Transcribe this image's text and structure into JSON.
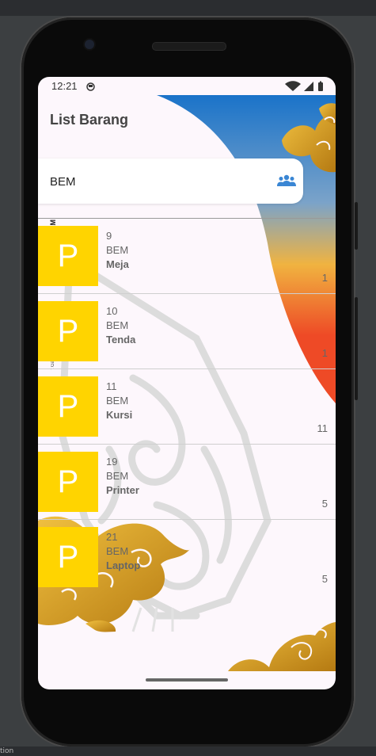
{
  "status_bar": {
    "time": "12:21"
  },
  "app": {
    "title": "List Barang"
  },
  "filter": {
    "value": "BEM",
    "icon": "group-icon"
  },
  "items": [
    {
      "thumb": "P",
      "id": "9",
      "org": "BEM",
      "name": "Meja",
      "qty": "1"
    },
    {
      "thumb": "P",
      "id": "10",
      "org": "BEM",
      "name": "Tenda",
      "qty": "1"
    },
    {
      "thumb": "P",
      "id": "11",
      "org": "BEM",
      "name": "Kursi",
      "qty": "11"
    },
    {
      "thumb": "P",
      "id": "19",
      "org": "BEM",
      "name": "Printer",
      "qty": "5"
    },
    {
      "thumb": "P",
      "id": "21",
      "org": "BEM",
      "name": "Laptop",
      "qty": "5"
    }
  ],
  "background_text": {
    "vertical_1": "AM",
    "vertical_2": "t Ga"
  },
  "bottom_strip": {
    "text": "tion"
  },
  "colors": {
    "thumb": "#ffd400",
    "accent": "#1e6fd9",
    "gold": "#d9a21c"
  }
}
